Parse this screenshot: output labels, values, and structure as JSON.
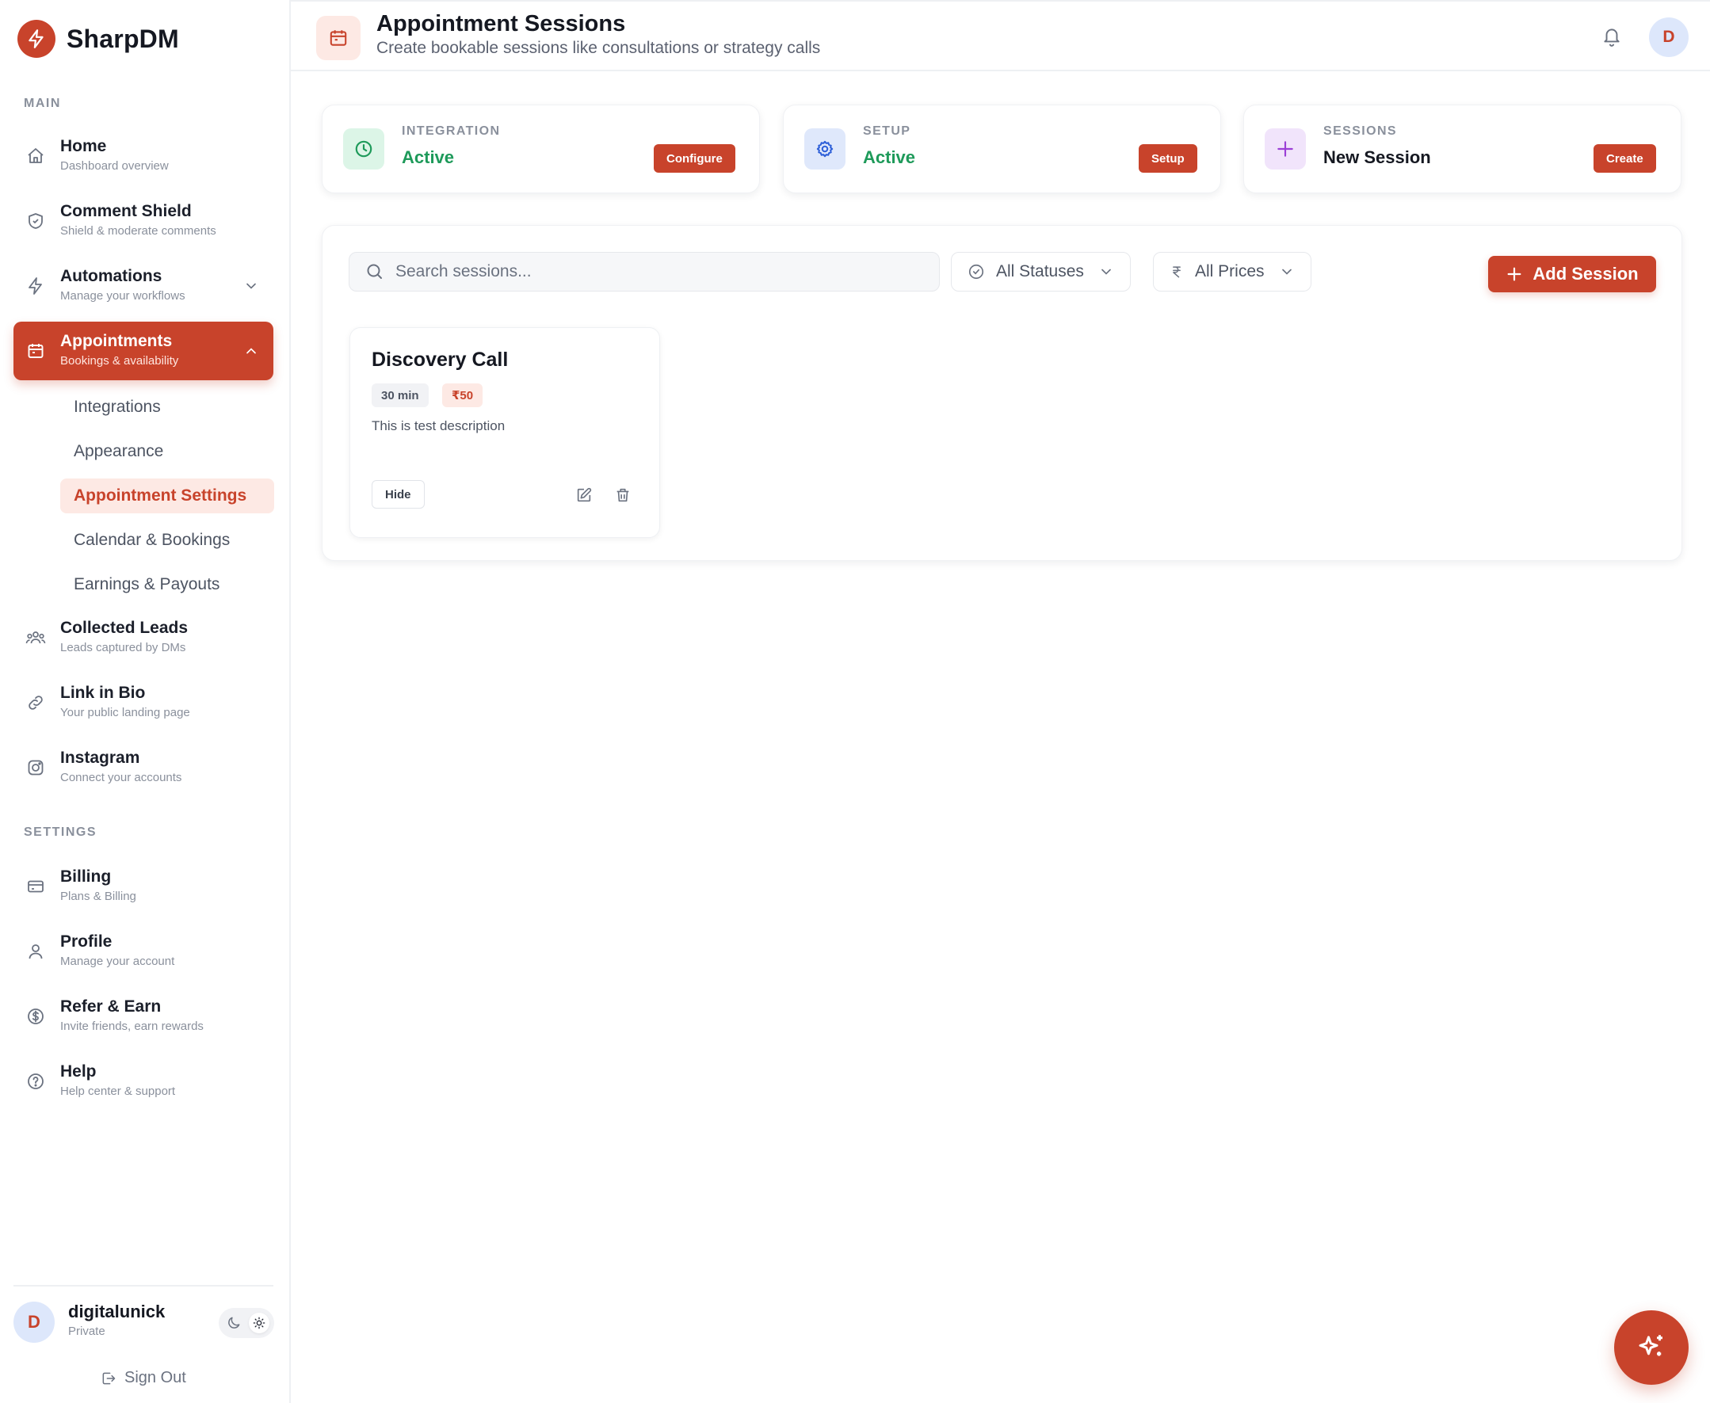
{
  "brand": {
    "name": "SharpDM"
  },
  "sidebar": {
    "main_label": "MAIN",
    "settings_label": "SETTINGS",
    "items": [
      {
        "title": "Home",
        "subtitle": "Dashboard overview",
        "icon": "home-icon"
      },
      {
        "title": "Comment Shield",
        "subtitle": "Shield & moderate comments",
        "icon": "shield-icon"
      },
      {
        "title": "Automations",
        "subtitle": "Manage your workflows",
        "icon": "bolt-icon"
      },
      {
        "title": "Appointments",
        "subtitle": "Bookings & availability",
        "icon": "calendar-icon"
      },
      {
        "title": "Collected Leads",
        "subtitle": "Leads captured by DMs",
        "icon": "users-icon"
      },
      {
        "title": "Link in Bio",
        "subtitle": "Your public landing page",
        "icon": "link-icon"
      },
      {
        "title": "Instagram",
        "subtitle": "Connect your accounts",
        "icon": "instagram-icon"
      }
    ],
    "appointment_subitems": [
      "Integrations",
      "Appearance",
      "Appointment Settings",
      "Calendar & Bookings",
      "Earnings & Payouts"
    ],
    "settings_items": [
      {
        "title": "Billing",
        "subtitle": "Plans & Billing",
        "icon": "card-icon"
      },
      {
        "title": "Profile",
        "subtitle": "Manage your account",
        "icon": "user-icon"
      },
      {
        "title": "Refer & Earn",
        "subtitle": "Invite friends, earn rewards",
        "icon": "dollar-icon"
      },
      {
        "title": "Help",
        "subtitle": "Help center & support",
        "icon": "help-icon"
      }
    ],
    "user": {
      "initial": "D",
      "name": "digitalunick",
      "plan": "Private"
    },
    "sign_out": "Sign Out"
  },
  "header": {
    "title": "Appointment Sessions",
    "subtitle": "Create bookable sessions like consultations or strategy calls",
    "avatar_initial": "D"
  },
  "stats": [
    {
      "label": "INTEGRATION",
      "value": "Active",
      "button": "Configure"
    },
    {
      "label": "SETUP",
      "value": "Active",
      "button": "Setup"
    },
    {
      "label": "SESSIONS",
      "value": "New Session",
      "button": "Create"
    }
  ],
  "toolbar": {
    "search_placeholder": "Search sessions...",
    "status_filter": "All Statuses",
    "price_filter": "All Prices",
    "add_button": "Add Session"
  },
  "sessions": [
    {
      "title": "Discovery Call",
      "duration": "30 min",
      "price": "₹50",
      "description": "This is test description",
      "hide_label": "Hide"
    }
  ],
  "colors": {
    "accent": "#c8432b",
    "success": "#1e9a5a"
  }
}
